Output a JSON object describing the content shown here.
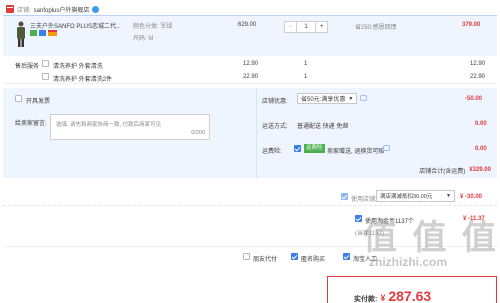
{
  "shop": {
    "store_label": "店铺:",
    "store_name": "sanfoplus户外旗舰店"
  },
  "item": {
    "title": "三夫户外SANFO PLUS恋城二代...",
    "sku_color": "颜色分类: 军绿",
    "sku_size": "尺码: M",
    "price": "629.00",
    "qty": "1",
    "promo": "省250:感恩回馈",
    "subtotal": "379.00"
  },
  "services": {
    "label": "售后服务",
    "rows": [
      {
        "name": "清洗养护 外套清洗",
        "price": "12.90",
        "qty": "1",
        "subtotal": "12.90"
      },
      {
        "name": "清洗养护 外套清洗2件",
        "price": "22.90",
        "qty": "1",
        "subtotal": "22.90"
      }
    ]
  },
  "invoice": {
    "label": "开具发票"
  },
  "shop_discount": {
    "label": "店铺优惠:",
    "value": "省50元:满享优惠",
    "amount": "-50.00"
  },
  "message": {
    "label": "给卖家留言:",
    "placeholder": "选填, 请先和商家协商一致, 付款后商家可见",
    "counter": "0/200"
  },
  "delivery": {
    "label": "运送方式:",
    "value": "普通配送 快递 免邮",
    "amount": "0.00"
  },
  "insurance": {
    "label": "运费险:",
    "badge": "运费险",
    "value": "卖家赠送, 退换货可赔",
    "amount": "0.00"
  },
  "store_total": {
    "label": "店铺合计(含运费)",
    "amount": "¥329.00"
  },
  "coupon": {
    "label": "使用店铺满",
    "select": "满店满减抵扣30.00元",
    "amount": "¥ -30.00"
  },
  "tmall_points": {
    "label": "使用淘金币1137个",
    "hint": "(当年1137)",
    "amount": "¥ -11.37"
  },
  "options": [
    {
      "label": "朋友代付",
      "checked": false
    },
    {
      "label": "匿名购买",
      "checked": true
    },
    {
      "label": "淘宝人工",
      "checked": true
    }
  ],
  "pay": {
    "label": "实付款:",
    "currency": "¥",
    "amount": "287.63"
  },
  "watermark": {
    "text": "值 值 值",
    "url": "zhizhizhi.com"
  },
  "colors": {
    "accent": "#e4393c",
    "link": "#3a7ee8",
    "green_badge": "#4caf50"
  }
}
